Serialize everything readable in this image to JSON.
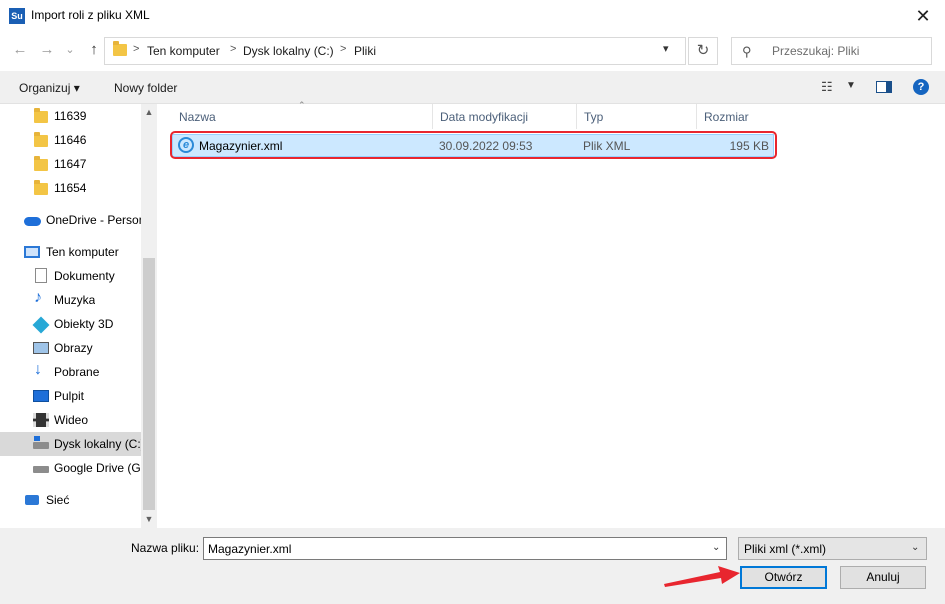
{
  "window": {
    "app_icon_text": "Su",
    "title": "Import roli z pliku XML",
    "close_glyph": "✕"
  },
  "nav": {
    "back": "←",
    "forward": "→",
    "history_drop": "⌄",
    "up": "↑",
    "breadcrumbs": [
      "Ten komputer",
      "Dysk lokalny (C:)",
      "Pliki"
    ],
    "separator": ">",
    "refresh": "↻",
    "search_placeholder": "Przeszukaj: Pliki"
  },
  "toolbar": {
    "organize": "Organizuj ▾",
    "new_folder": "Nowy folder",
    "help": "?"
  },
  "sidebar": {
    "items": [
      {
        "label": "11639",
        "icon": "folder-icon"
      },
      {
        "label": "11646",
        "icon": "folder-icon"
      },
      {
        "label": "11647",
        "icon": "folder-icon"
      },
      {
        "label": "11654",
        "icon": "folder-icon"
      },
      {
        "label": "OneDrive - Personal",
        "icon": "onedrive-icon"
      },
      {
        "label": "Ten komputer",
        "icon": "computer-icon"
      },
      {
        "label": "Dokumenty",
        "icon": "documents-icon"
      },
      {
        "label": "Muzyka",
        "icon": "music-icon"
      },
      {
        "label": "Obiekty 3D",
        "icon": "3d-objects-icon"
      },
      {
        "label": "Obrazy",
        "icon": "pictures-icon"
      },
      {
        "label": "Pobrane",
        "icon": "downloads-icon"
      },
      {
        "label": "Pulpit",
        "icon": "desktop-icon"
      },
      {
        "label": "Wideo",
        "icon": "video-icon"
      },
      {
        "label": "Dysk lokalny (C:)",
        "icon": "local-disk-icon"
      },
      {
        "label": "Google Drive (G:)",
        "icon": "drive-icon"
      },
      {
        "label": "Sieć",
        "icon": "network-icon"
      }
    ]
  },
  "columns": [
    "Nazwa",
    "Data modyfikacji",
    "Typ",
    "Rozmiar"
  ],
  "files": [
    {
      "name": "Magazynier.xml",
      "modified": "30.09.2022 09:53",
      "type": "Plik XML",
      "size": "195 KB",
      "selected": true
    }
  ],
  "footer": {
    "filename_label": "Nazwa pliku:",
    "filename_value": "Magazynier.xml",
    "filetype_value": "Pliki xml (*.xml)",
    "open_button": "Otwórz",
    "cancel_button": "Anuluj"
  },
  "colors": {
    "accent": "#0078d7",
    "selection": "#cce8ff",
    "highlight": "#e8262f"
  }
}
